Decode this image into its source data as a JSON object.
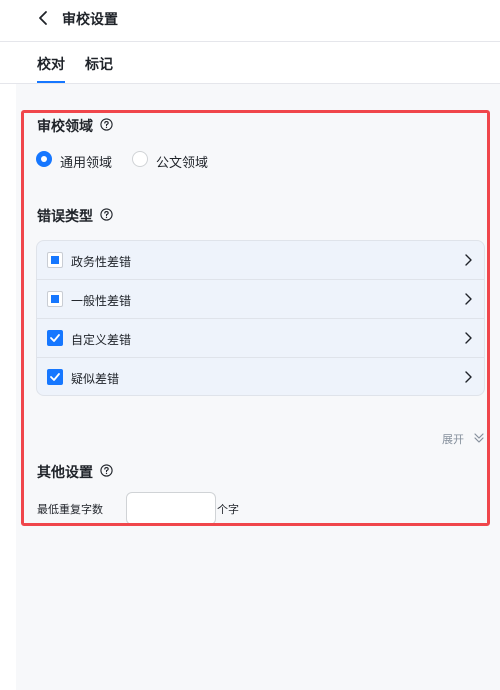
{
  "header": {
    "title": "审校设置",
    "back_icon": "chevron-left-icon"
  },
  "tabs": [
    {
      "label": "校对",
      "active": true
    },
    {
      "label": "标记",
      "active": false
    }
  ],
  "domain_section": {
    "title": "审校领域",
    "help_icon": "question-circle-icon",
    "options": [
      {
        "label": "通用领域",
        "checked": true
      },
      {
        "label": "公文领域",
        "checked": false
      }
    ]
  },
  "error_section": {
    "title": "错误类型",
    "help_icon": "question-circle-icon",
    "items": [
      {
        "label": "政务性差错",
        "state": "partial"
      },
      {
        "label": "一般性差错",
        "state": "partial"
      },
      {
        "label": "自定义差错",
        "state": "checked"
      },
      {
        "label": "疑似差错",
        "state": "checked"
      }
    ],
    "expand_label": "展开"
  },
  "other_section": {
    "title": "其他设置",
    "help_icon": "question-circle-icon",
    "min_repeat_label": "最低重复字数",
    "min_repeat_value": "",
    "min_repeat_unit": "个字"
  },
  "colors": {
    "accent": "#1677ff",
    "highlight_border": "#f0464b",
    "list_bg": "#eef3fb"
  }
}
